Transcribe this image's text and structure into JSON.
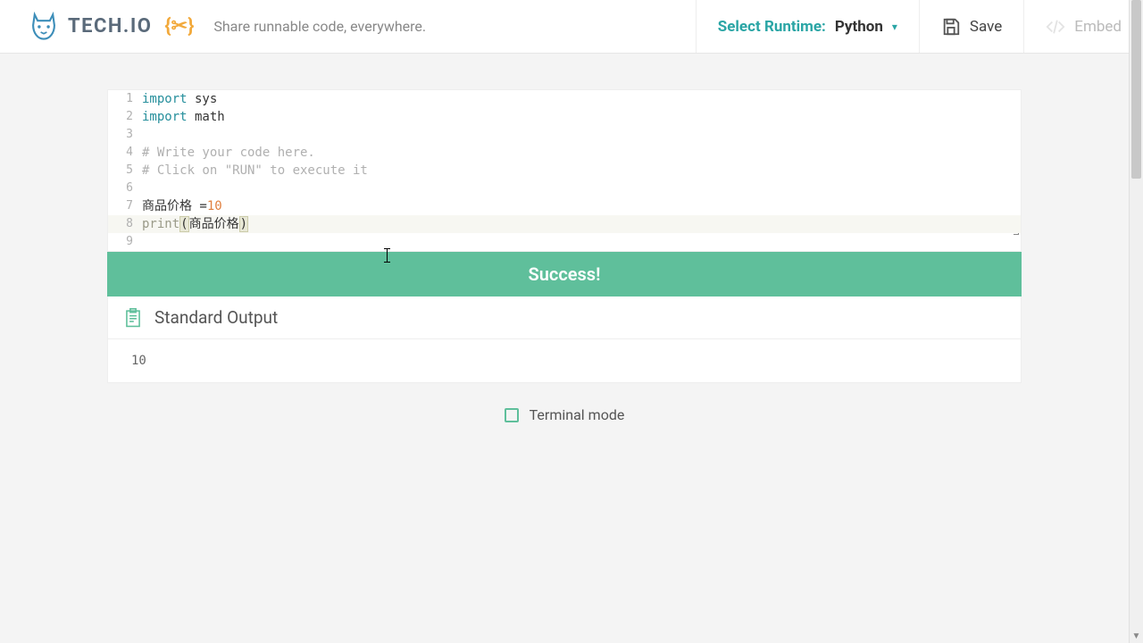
{
  "header": {
    "brand": "TECH.IO",
    "braces": "{✂}",
    "tagline": "Share runnable code, everywhere.",
    "runtime_label": "Select Runtime:",
    "runtime_value": "Python",
    "save_label": "Save",
    "embed_label": "Embed"
  },
  "editor": {
    "lines": [
      {
        "n": "1",
        "tokens": [
          [
            "kw",
            "import"
          ],
          [
            "",
            " sys"
          ]
        ]
      },
      {
        "n": "2",
        "tokens": [
          [
            "kw",
            "import"
          ],
          [
            "",
            " math"
          ]
        ]
      },
      {
        "n": "3",
        "tokens": []
      },
      {
        "n": "4",
        "tokens": [
          [
            "com",
            "# Write your code here."
          ]
        ]
      },
      {
        "n": "5",
        "tokens": [
          [
            "com",
            "# Click on \"RUN\" to execute it"
          ]
        ]
      },
      {
        "n": "6",
        "tokens": []
      },
      {
        "n": "7",
        "tokens": [
          [
            "",
            "商品价格 ="
          ],
          [
            "num",
            "10"
          ]
        ]
      },
      {
        "n": "8",
        "highlighted": true,
        "tokens": [
          [
            "fn",
            "print"
          ],
          [
            "bracket-match",
            "("
          ],
          [
            "",
            "商品价格"
          ],
          [
            "bracket-match",
            ")"
          ]
        ]
      },
      {
        "n": "9",
        "tokens": []
      }
    ]
  },
  "result": {
    "banner": "Success!",
    "output_title": "Standard Output",
    "output_body": "10",
    "terminal_label": "Terminal mode"
  },
  "colors": {
    "accent_teal": "#2aa5a5",
    "success_green": "#5fbf9b",
    "brace_orange": "#f2a93b"
  }
}
